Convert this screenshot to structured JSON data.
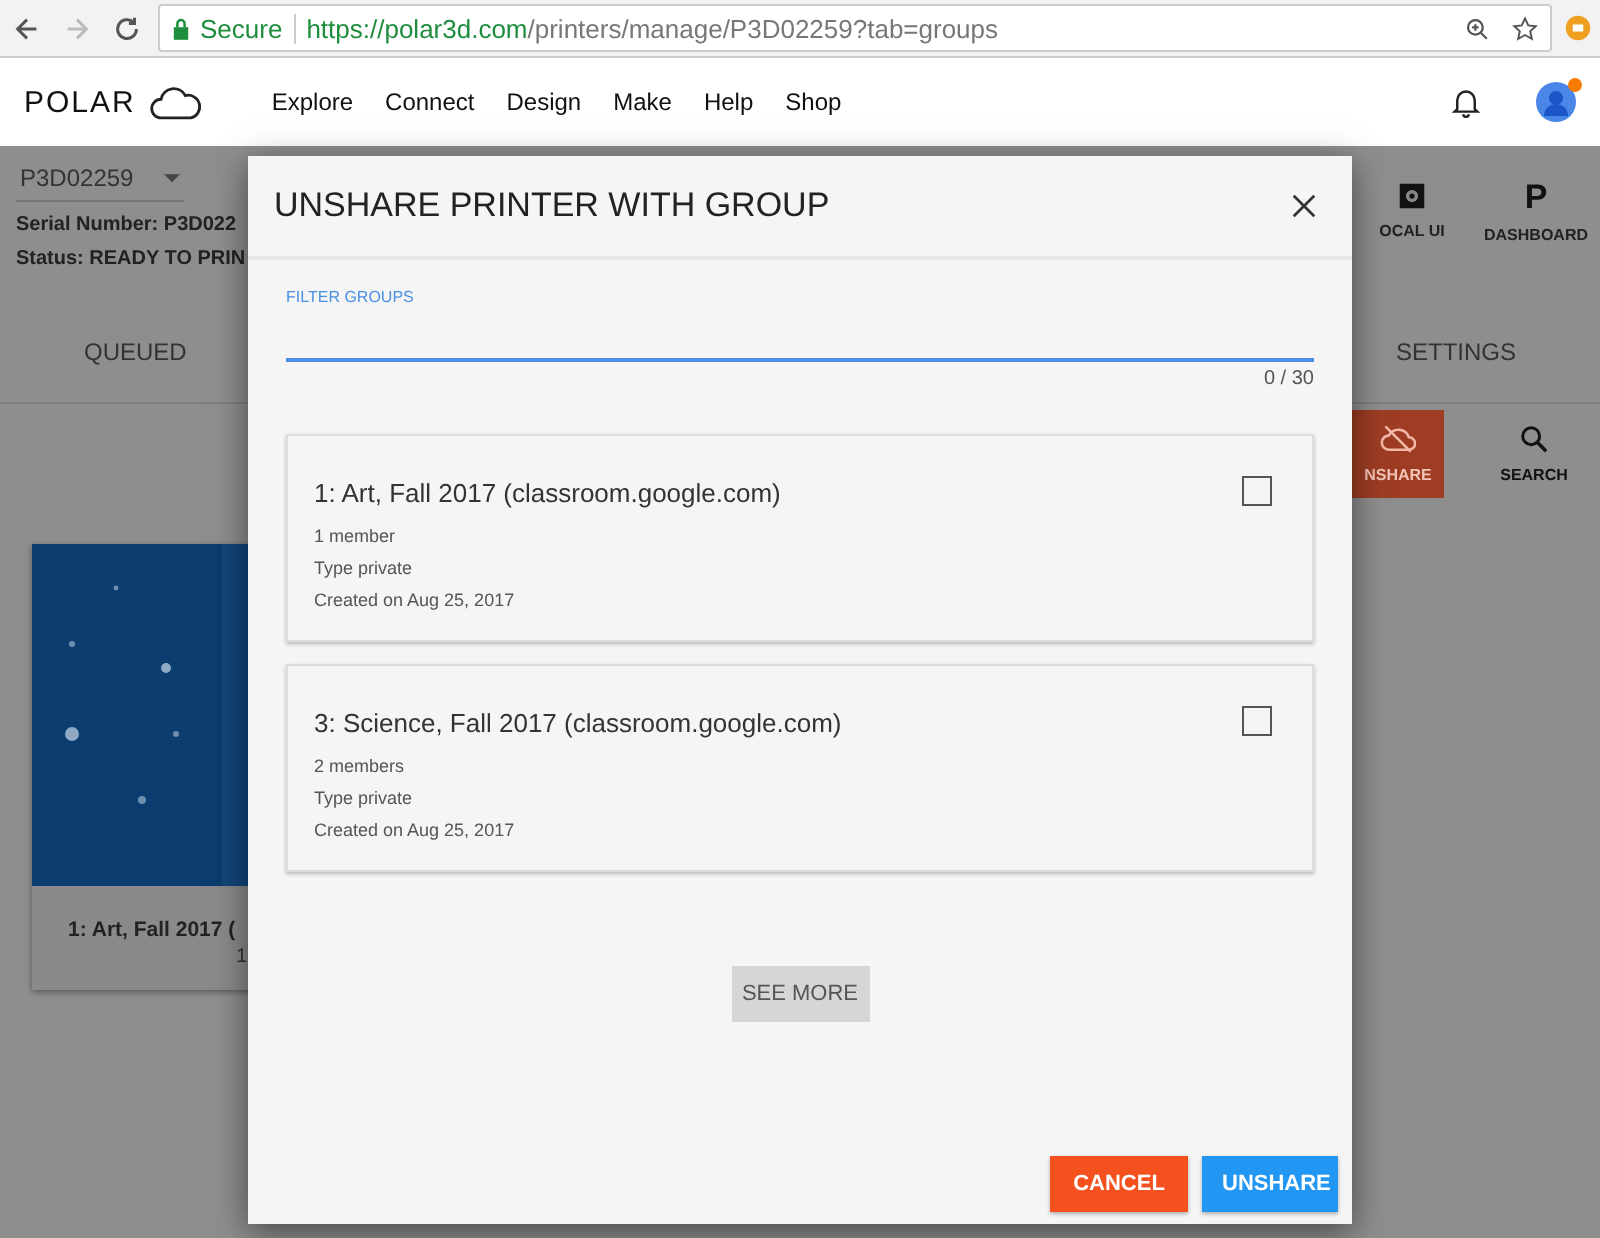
{
  "browser": {
    "secure_label": "Secure",
    "url_host": "https://polar3d.com",
    "url_path": "/printers/manage/P3D02259?tab=groups"
  },
  "nav": {
    "logo": "POLAR",
    "links": [
      "Explore",
      "Connect",
      "Design",
      "Make",
      "Help",
      "Shop"
    ],
    "notification_dot": true
  },
  "printer": {
    "selector": "P3D02259",
    "serial": "Serial Number: P3D022",
    "status": "Status: READY TO PRIN"
  },
  "toolbar": [
    {
      "label": "OCAL UI",
      "kind": "gear"
    },
    {
      "label": "DASHBOARD",
      "kind": "letter",
      "glyph": "P"
    }
  ],
  "tabs": [
    {
      "label": "QUEUED"
    },
    {
      "label": "SETTINGS"
    }
  ],
  "actions": [
    {
      "label": "NSHARE",
      "kind": "unshare"
    },
    {
      "label": "SEARCH",
      "kind": "search"
    }
  ],
  "cards": [
    {
      "kind": "picture",
      "title": "1: Art, Fall 2017 (",
      "subtitle": "1"
    }
  ],
  "dialog": {
    "title": "UNSHARE PRINTER WITH GROUP",
    "filter": {
      "label": "FILTER GROUPS",
      "counter": "0 / 30"
    },
    "groups": [
      {
        "title": "1: Art, Fall 2017 (classroom.google.com)",
        "lines": [
          "1 member",
          "Type private",
          "Created on Aug 25, 2017"
        ],
        "checked": false
      },
      {
        "title": "3: Science, Fall 2017 (classroom.google.com)",
        "lines": [
          "2 members",
          "Type private",
          "Created on Aug 25, 2017"
        ],
        "checked": false
      }
    ],
    "see_more": "SEE MORE",
    "buttons": [
      {
        "label": "CANCEL",
        "kind": "cancel"
      },
      {
        "label": "UNSHARE",
        "kind": "confirm"
      }
    ]
  }
}
